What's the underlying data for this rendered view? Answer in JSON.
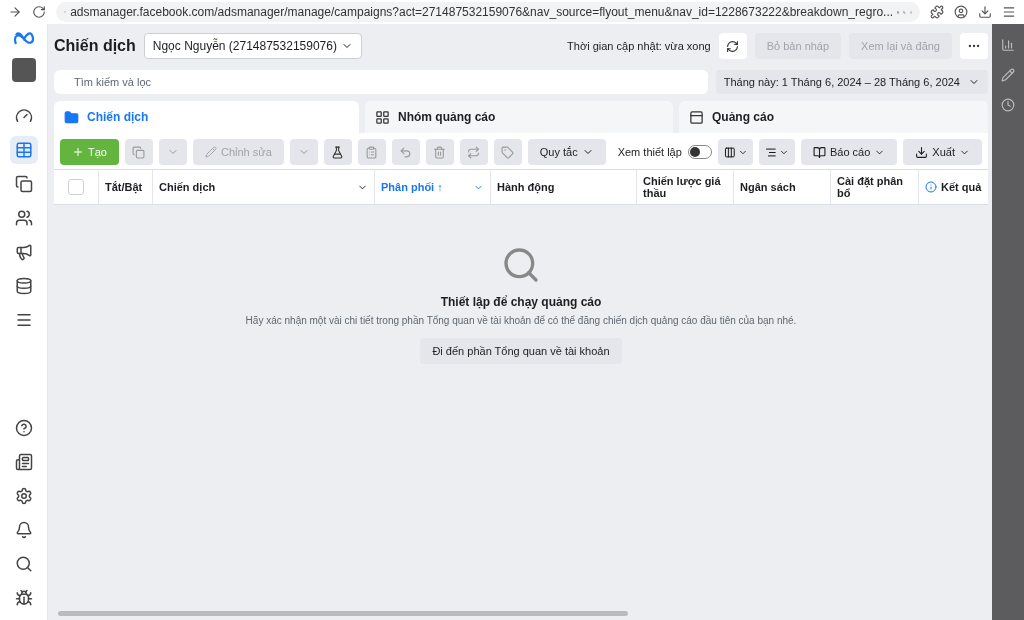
{
  "browser": {
    "url": "adsmanager.facebook.com/adsmanager/manage/campaigns?act=271487532159076&nav_source=flyout_menu&nav_id=1228673222&breakdown_regro..."
  },
  "sidebar": {
    "items": [
      {
        "kind": "dashboard",
        "selected": false
      },
      {
        "kind": "table",
        "selected": true
      },
      {
        "kind": "pages",
        "selected": false
      },
      {
        "kind": "audience",
        "selected": false
      },
      {
        "kind": "megaphone",
        "selected": false
      },
      {
        "kind": "billing",
        "selected": false
      },
      {
        "kind": "menu",
        "selected": false
      }
    ],
    "bottom": [
      {
        "kind": "help"
      },
      {
        "kind": "news"
      },
      {
        "kind": "settings"
      },
      {
        "kind": "bell"
      },
      {
        "kind": "search"
      },
      {
        "kind": "bug"
      }
    ]
  },
  "header": {
    "title": "Chiến dịch",
    "account": "Ngọc Nguyễn (271487532159076)",
    "updated": "Thời gian cập nhật: vừa xong",
    "buttons": [
      {
        "label": "Bỏ bản nháp",
        "disabled": true
      },
      {
        "label": "Xem lại và đăng",
        "disabled": true
      }
    ]
  },
  "search": {
    "placeholder": "Tìm kiếm và lọc"
  },
  "date_range": "Tháng này: 1 Tháng 6, 2024 – 28 Tháng 6, 2024",
  "tabs": [
    {
      "label": "Chiến dịch",
      "selected": true,
      "kind": "campaign"
    },
    {
      "label": "Nhóm quảng cáo",
      "selected": false,
      "kind": "adset"
    },
    {
      "label": "Quảng cáo",
      "selected": false,
      "kind": "ad"
    }
  ],
  "toolbar": {
    "create": "Tạo",
    "edit": "Chỉnh sửa",
    "rules": "Quy tắc",
    "view_setup": {
      "label": "Xem thiết lập",
      "on": false
    },
    "report": "Báo cáo",
    "export": "Xuất"
  },
  "table": {
    "select_all": {
      "checked": false
    },
    "columns": [
      {
        "label": "Tắt/Bật",
        "sorted": false,
        "menu": false,
        "info": false
      },
      {
        "label": "Chiến dịch",
        "sorted": false,
        "menu": true,
        "info": false
      },
      {
        "label": "Phân phối ↑",
        "sorted": true,
        "menu": true,
        "info": false
      },
      {
        "label": "Hành động",
        "sorted": false,
        "menu": false,
        "info": false
      },
      {
        "label": "Chiến lược giá thầu",
        "sorted": false,
        "menu": false,
        "info": false
      },
      {
        "label": "Ngân sách",
        "sorted": false,
        "menu": false,
        "info": false
      },
      {
        "label": "Cài đặt phân bổ",
        "sorted": false,
        "menu": false,
        "info": false
      },
      {
        "label": "Kết quả",
        "sorted": false,
        "menu": false,
        "info": true
      }
    ]
  },
  "empty_state": {
    "title": "Thiết lập để chạy quảng cáo",
    "message": "Hãy xác nhận một vài chi tiết trong phần Tổng quan về tài khoản để có thể đăng chiến dịch quảng cáo đầu tiên của bạn nhé.",
    "button": "Đi đến phần Tổng quan về tài khoản"
  }
}
